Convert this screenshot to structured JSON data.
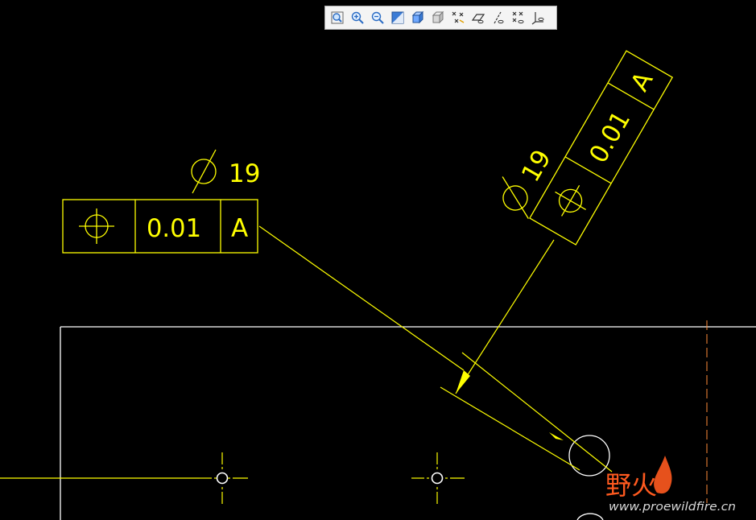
{
  "toolbar": {
    "buttons": [
      {
        "icon": "zoom-window-icon"
      },
      {
        "icon": "zoom-in-icon"
      },
      {
        "icon": "zoom-out-icon"
      },
      {
        "icon": "repaint-icon"
      },
      {
        "icon": "shaded-view-icon"
      },
      {
        "icon": "hidden-line-icon"
      },
      {
        "icon": "datum-points-icon"
      },
      {
        "icon": "datum-planes-icon"
      },
      {
        "icon": "datum-axes-icon"
      },
      {
        "icon": "coordinate-systems-icon"
      },
      {
        "icon": "csys-display-icon"
      }
    ]
  },
  "fcf1": {
    "dim_value": "19",
    "tolerance": "0.01",
    "datum": "A"
  },
  "fcf2": {
    "dim_value": "19",
    "tolerance": "0.01",
    "datum": "A"
  },
  "watermark": {
    "cn_text": "野火",
    "url": "www.proewildfire.cn"
  },
  "colors": {
    "background": "#000000",
    "annotation": "#ffff00",
    "geometry": "#ffffff",
    "watermark_accent": "#ff5a1f"
  }
}
